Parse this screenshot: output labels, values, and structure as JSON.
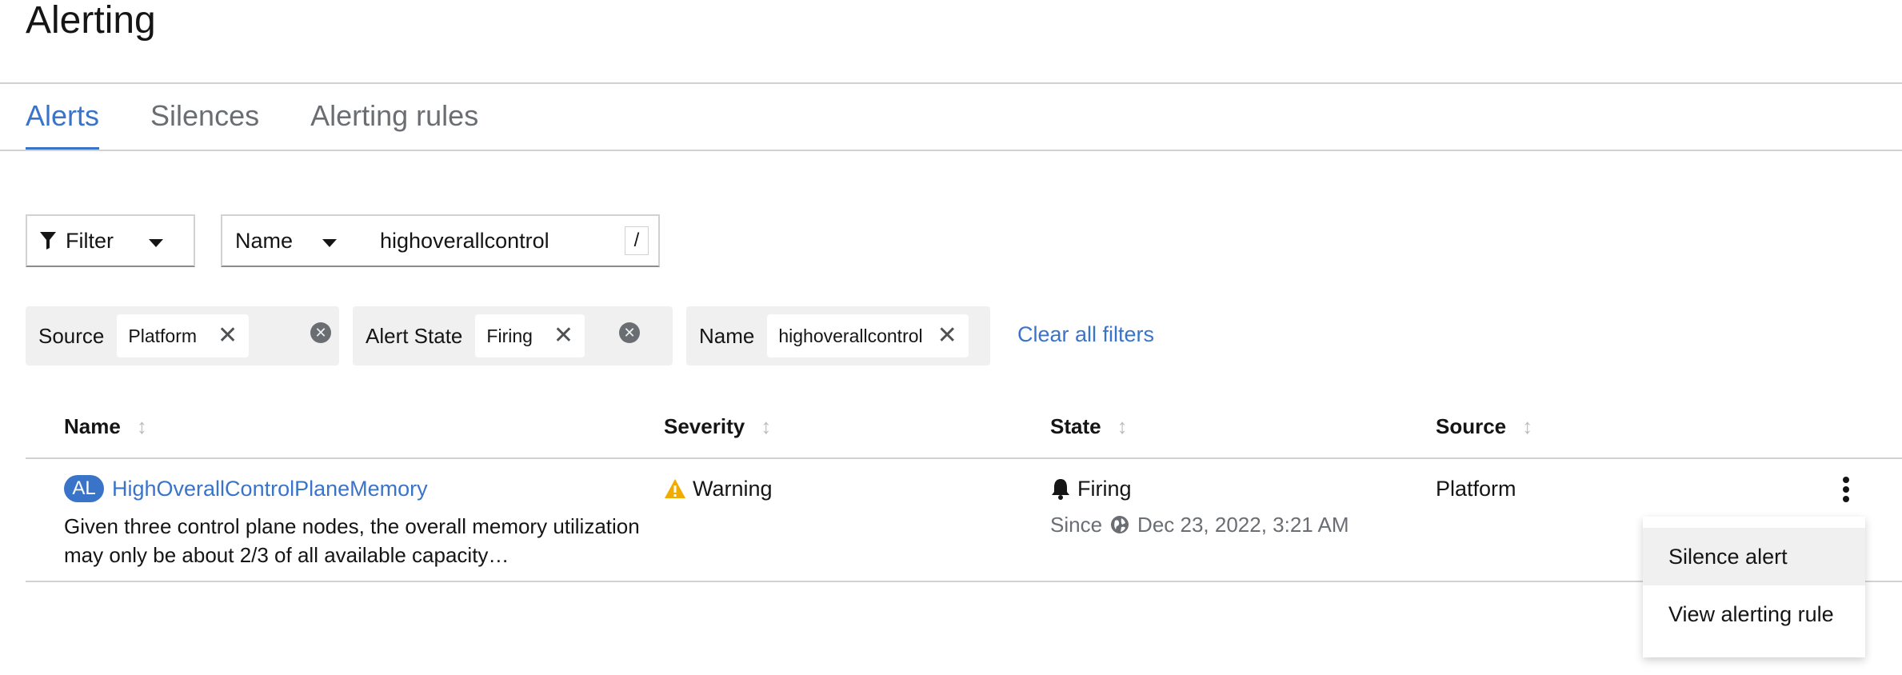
{
  "page": {
    "title": "Alerting"
  },
  "tabs": [
    {
      "label": "Alerts",
      "active": true
    },
    {
      "label": "Silences",
      "active": false
    },
    {
      "label": "Alerting rules",
      "active": false
    }
  ],
  "toolbar": {
    "filter_label": "Filter",
    "attribute_label": "Name",
    "search_value": "highoverallcontrol",
    "shortcut_hint": "/"
  },
  "chip_groups": [
    {
      "category": "Source",
      "chips": [
        "Platform"
      ]
    },
    {
      "category": "Alert State",
      "chips": [
        "Firing"
      ]
    },
    {
      "category": "Name",
      "chips": [
        "highoverallcontrol"
      ]
    }
  ],
  "clear_filters_label": "Clear all filters",
  "table": {
    "columns": [
      "Name",
      "Severity",
      "State",
      "Source"
    ],
    "rows": [
      {
        "badge": "AL",
        "name": "HighOverallControlPlaneMemory",
        "description": "Given three control plane nodes, the overall memory utilization may only be about 2/3 of all available capacity…",
        "severity": "Warning",
        "state": "Firing",
        "since_label": "Since",
        "since_time": "Dec 23, 2022, 3:21 AM",
        "source": "Platform"
      }
    ]
  },
  "row_menu": {
    "items": [
      "Silence alert",
      "View alerting rule"
    ]
  },
  "colors": {
    "accent": "#3a74c9",
    "warning": "#f0ab00",
    "chip_group_bg": "#f0f0f0"
  },
  "icons": [
    "filter-icon",
    "caret-down-icon",
    "close-icon",
    "circle-close-icon",
    "sort-icon",
    "warning-icon",
    "bell-icon",
    "globe-icon",
    "kebab-icon"
  ]
}
